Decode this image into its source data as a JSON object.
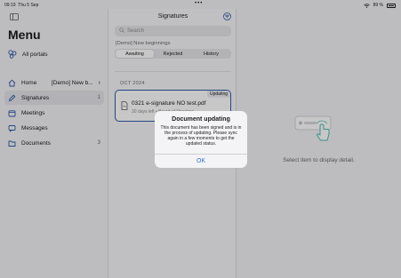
{
  "status_bar": {
    "time": "09:19",
    "date": "Thu 5 Sep",
    "battery": "89 %",
    "dots": "•••"
  },
  "sidebar": {
    "title": "Menu",
    "all_portals": "All portals",
    "items": [
      {
        "label": "Home",
        "portal": "[Demo] New b...",
        "icon": "house-icon"
      },
      {
        "label": "Signatures",
        "badge": "1",
        "icon": "pen-icon",
        "active": true
      },
      {
        "label": "Meetings",
        "icon": "calendar-icon"
      },
      {
        "label": "Messages",
        "icon": "message-icon"
      },
      {
        "label": "Documents",
        "badge": "3",
        "icon": "folder-icon"
      }
    ]
  },
  "middle": {
    "title": "Signatures",
    "search_placeholder": "Search",
    "portal_label": "[Demo] New beginnings",
    "tabs": [
      "Awaiting",
      "Rejected",
      "History"
    ],
    "active_tab": "Awaiting",
    "section": "OCT 2024",
    "document": {
      "status": "Updating",
      "name": "0321 e-signature NO test.pdf",
      "meta": "30 days left • Board of Directors"
    }
  },
  "detail": {
    "placeholder": "Select item to display detail."
  },
  "alert": {
    "title": "Document updating",
    "message": "This document has been signed and is in the process of updating. Please sync again in a few moments to get the updated status.",
    "ok_label": "OK"
  },
  "colors": {
    "accent": "#2f6fd6",
    "card_border": "#2f5aa8",
    "illustration": "#4fbcb0"
  }
}
